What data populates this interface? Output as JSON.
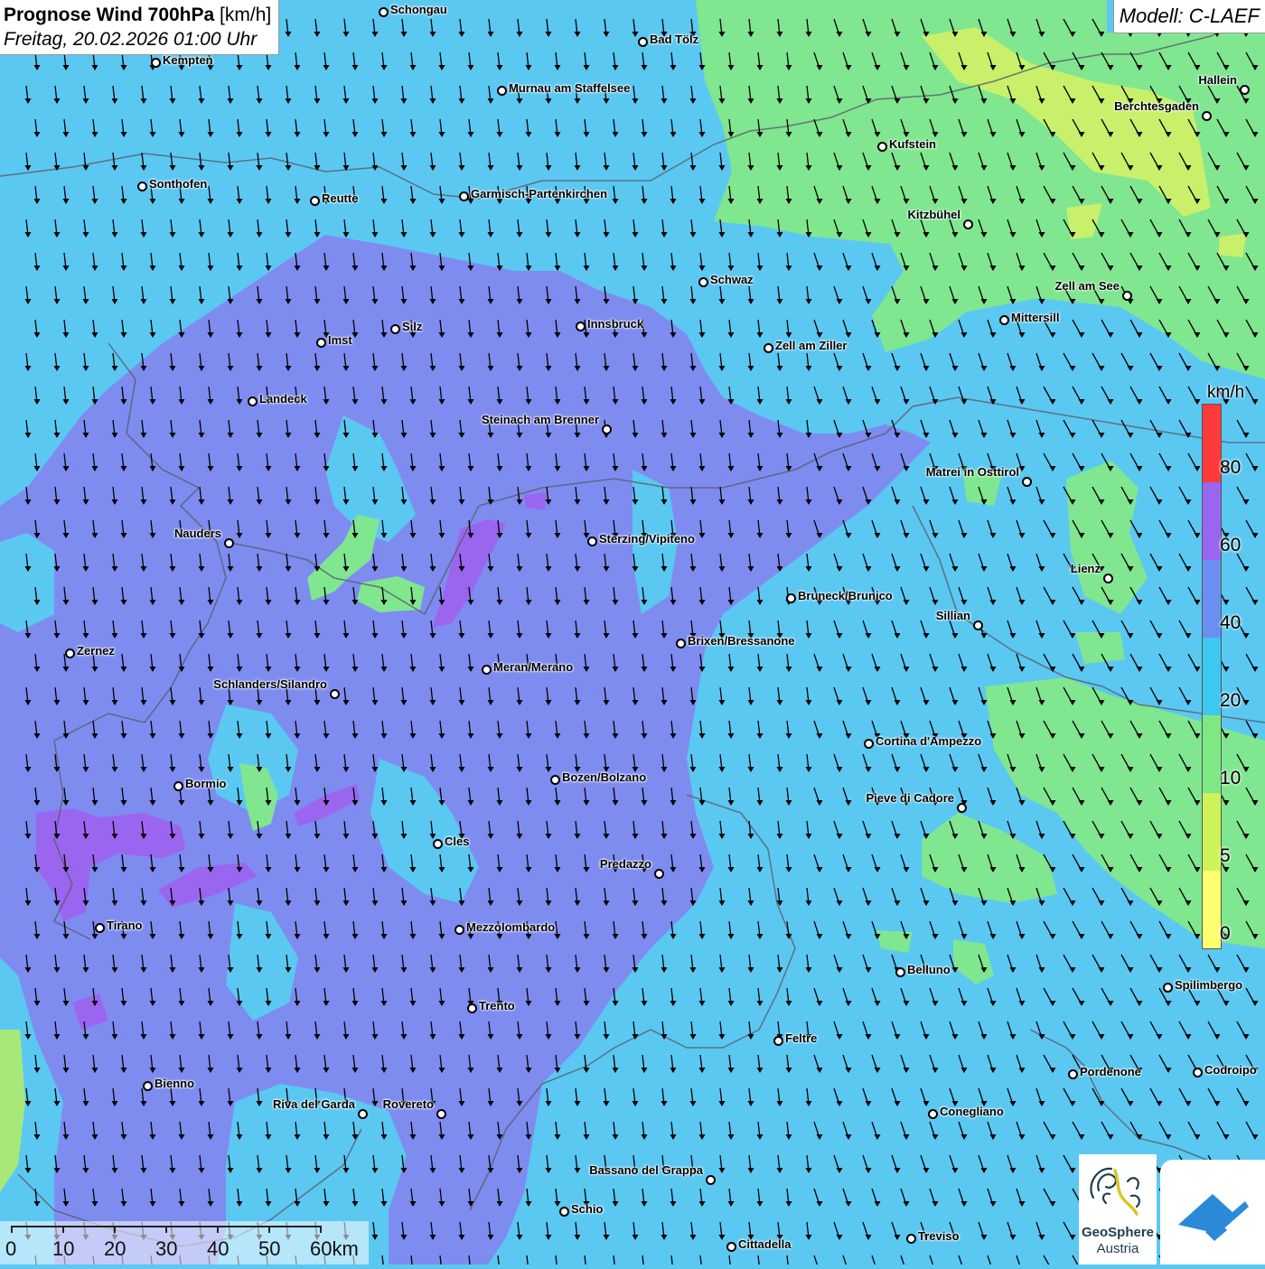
{
  "title": {
    "main": "Prognose Wind 700hPa",
    "unit": "[km/h]",
    "date": "Freitag, 20.02.2026 01:00 Uhr"
  },
  "model": "Modell: C-LAEF",
  "legend": {
    "unit": "km/h",
    "labels": [
      "80",
      "60",
      "40",
      "20",
      "10",
      "5",
      "0"
    ],
    "colors": [
      "#ff3a3a",
      "#9a66f0",
      "#6b8ff0",
      "#3cc8f0",
      "#7ee882",
      "#cdf25a",
      "#ffff70"
    ]
  },
  "scale": {
    "labels": [
      "0",
      "10",
      "20",
      "30",
      "40",
      "50",
      "60km"
    ]
  },
  "logo": {
    "line1": "GeoSphere",
    "line2": "Austria"
  },
  "cities": [
    {
      "name": "Schongau"
    },
    {
      "name": "Bad Tölz"
    },
    {
      "name": "Kempten"
    },
    {
      "name": "Murnau am Staffelsee"
    },
    {
      "name": "Hallein"
    },
    {
      "name": "Berchtesgaden"
    },
    {
      "name": "Kufstein"
    },
    {
      "name": "Sonthofen"
    },
    {
      "name": "Reutte"
    },
    {
      "name": "Garmisch-Partenkirchen"
    },
    {
      "name": "Kitzbühel"
    },
    {
      "name": "Schwaz"
    },
    {
      "name": "Zell am See"
    },
    {
      "name": "Mittersill"
    },
    {
      "name": "Silz"
    },
    {
      "name": "Innsbruck"
    },
    {
      "name": "Imst"
    },
    {
      "name": "Zell am Ziller"
    },
    {
      "name": "Landeck"
    },
    {
      "name": "Steinach am Brenner"
    },
    {
      "name": "Matrei in Osttirol"
    },
    {
      "name": "Nauders"
    },
    {
      "name": "Sterzing/Vipiteno"
    },
    {
      "name": "Lienz"
    },
    {
      "name": "Bruneck/Brunico"
    },
    {
      "name": "Sillian"
    },
    {
      "name": "Zernez"
    },
    {
      "name": "Brixen/Bressanone"
    },
    {
      "name": "Meran/Merano"
    },
    {
      "name": "Schlanders/Silandro"
    },
    {
      "name": "Cortina d'Ampezzo"
    },
    {
      "name": "Bozen/Bolzano"
    },
    {
      "name": "Bormio"
    },
    {
      "name": "Pieve di Cadore"
    },
    {
      "name": "Cles"
    },
    {
      "name": "Predazzo"
    },
    {
      "name": "Tirano"
    },
    {
      "name": "Mezzolombardo"
    },
    {
      "name": "Belluno"
    },
    {
      "name": "Spilimbergo"
    },
    {
      "name": "Trento"
    },
    {
      "name": "Feltre"
    },
    {
      "name": "Pordenone"
    },
    {
      "name": "Codroipo"
    },
    {
      "name": "Bienno"
    },
    {
      "name": "Riva del Garda"
    },
    {
      "name": "Rovereto"
    },
    {
      "name": "Conegliano"
    },
    {
      "name": "Bassano del Grappa"
    },
    {
      "name": "Schio"
    },
    {
      "name": "Treviso"
    },
    {
      "name": "Cittadella"
    }
  ]
}
